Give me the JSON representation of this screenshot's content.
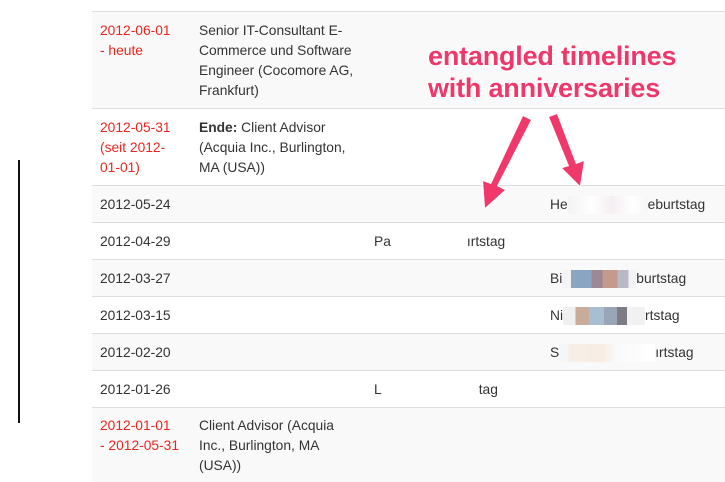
{
  "annotation": {
    "line1": "entangled timelines",
    "line2": "with anniversaries",
    "color": "#f0376a"
  },
  "colors": {
    "date_red": "#e8261f",
    "text": "#333333",
    "row_alt": "#f9f9f9",
    "border": "#dddddd"
  },
  "rows": [
    {
      "date_line1": "2012-06-01",
      "date_line2": "- heute",
      "date_line3": "",
      "job_bold": "",
      "job_line1": "Senior IT-Consultant E-",
      "job_line2": "Commerce und Software",
      "job_line3": "Engineer (Cocomore AG,",
      "job_line4": "Frankfurt)"
    },
    {
      "date_line1": "2012-05-31",
      "date_line2": "(seit 2012-",
      "date_line3": "01-01)",
      "job_bold": "Ende:",
      "job_line1": " Client Advisor",
      "job_line2": "(Acquia Inc., Burlington,",
      "job_line3": "MA (USA))",
      "job_line4": ""
    },
    {
      "date": "2012-05-24",
      "right_a": "He",
      "right_b": "eburtstag"
    },
    {
      "date": "2012-04-29",
      "mid_a": "Pa",
      "mid_b": "ırtstag"
    },
    {
      "date": "2012-03-27",
      "right_a": "Bi",
      "right_b": "burtstag"
    },
    {
      "date": "2012-03-15",
      "right_a": "Ni",
      "right_b": "rtstag"
    },
    {
      "date": "2012-02-20",
      "right_a": "S",
      "right_b": "ırtstag"
    },
    {
      "date": "2012-01-26",
      "mid_a": "L",
      "mid_b": "tag"
    },
    {
      "date_line1": "2012-01-01",
      "date_line2": "- 2012-05-31",
      "job_line1": "Client Advisor (Acquia",
      "job_line2": "Inc., Burlington, MA",
      "job_line3": "(USA))"
    }
  ]
}
